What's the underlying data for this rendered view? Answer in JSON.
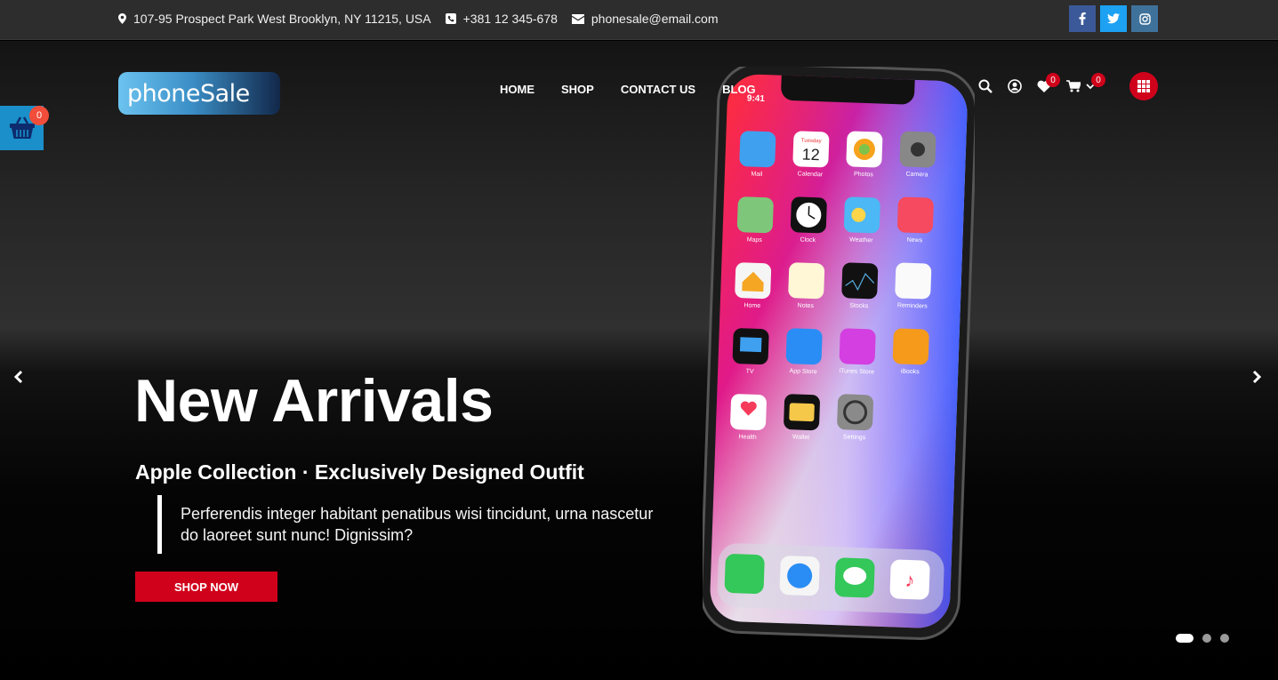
{
  "topbar": {
    "address": "107-95 Prospect Park West Brooklyn, NY 11215, USA",
    "phone": "+381 12 345-678",
    "email": "phonesale@email.com",
    "social": [
      "f",
      "t",
      "ig"
    ]
  },
  "logo": {
    "text": "phoneSale"
  },
  "nav": {
    "items": [
      "HOME",
      "SHOP",
      "CONTACT US",
      "BLOG"
    ]
  },
  "header_icons": {
    "wishlist_count": "0",
    "cart_count": "0"
  },
  "side_cart": {
    "count": "0"
  },
  "hero": {
    "headline": "New Arrivals",
    "subheadline": "Apple Collection · Exclusively Designed Outfit",
    "description": "Perferendis integer habitant penatibus wisi tincidunt, urna nascetur do laoreet sunt nunc! Dignissim?",
    "cta": "SHOP NOW"
  },
  "phone_screen": {
    "time": "9:41",
    "calendar_day": "Tuesday",
    "calendar_date": "12",
    "apps": [
      "Mail",
      "Calendar",
      "Photos",
      "Camera",
      "Maps",
      "Clock",
      "Weather",
      "News",
      "Home",
      "Notes",
      "Stocks",
      "Reminders",
      "TV",
      "App Store",
      "iTunes Store",
      "iBooks",
      "Health",
      "Wallet",
      "Settings"
    ]
  },
  "slider": {
    "slides": 3,
    "active_slide": 1
  },
  "colors": {
    "accent": "#d0021b",
    "topbar": "#2d2d2d",
    "side_cart": "#1a8fc9"
  }
}
